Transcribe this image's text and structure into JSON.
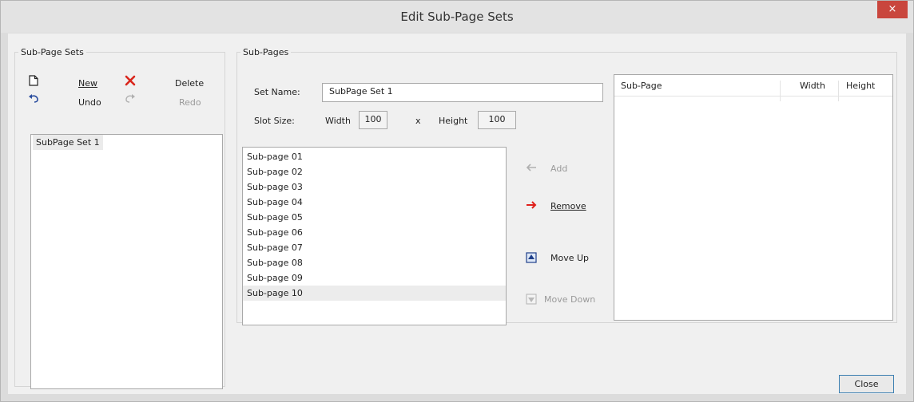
{
  "window": {
    "title": "Edit Sub-Page Sets",
    "close_glyph": "×"
  },
  "left_group": {
    "legend": "Sub-Page Sets",
    "toolbar": {
      "new_label": "New",
      "delete_label": "Delete",
      "undo_label": "Undo",
      "redo_label": "Redo"
    },
    "sets": [
      "SubPage Set 1"
    ]
  },
  "subpages_group": {
    "legend": "Sub-Pages",
    "set_name_label": "Set Name:",
    "set_name_value": "SubPage Set 1",
    "slot_size_label": "Slot Size:",
    "width_label": "Width",
    "width_value": "100",
    "x_label": "x",
    "height_label": "Height",
    "height_value": "100",
    "available": [
      "Sub-page 01",
      "Sub-page 02",
      "Sub-page 03",
      "Sub-page 04",
      "Sub-page 05",
      "Sub-page 06",
      "Sub-page 07",
      "Sub-page 08",
      "Sub-page 09",
      "Sub-page 10"
    ],
    "selected_index": 9,
    "actions": {
      "add_label": "Add",
      "remove_label": "Remove",
      "move_up_label": "Move Up",
      "move_down_label": "Move Down"
    },
    "grid": {
      "columns": [
        "Sub-Page",
        "Width",
        "Height"
      ],
      "rows": []
    }
  },
  "footer": {
    "close_label": "Close"
  },
  "colors": {
    "remove_arrow": "#e0201b",
    "delete_icon": "#d9261c",
    "close_accent": "#c9463d"
  }
}
